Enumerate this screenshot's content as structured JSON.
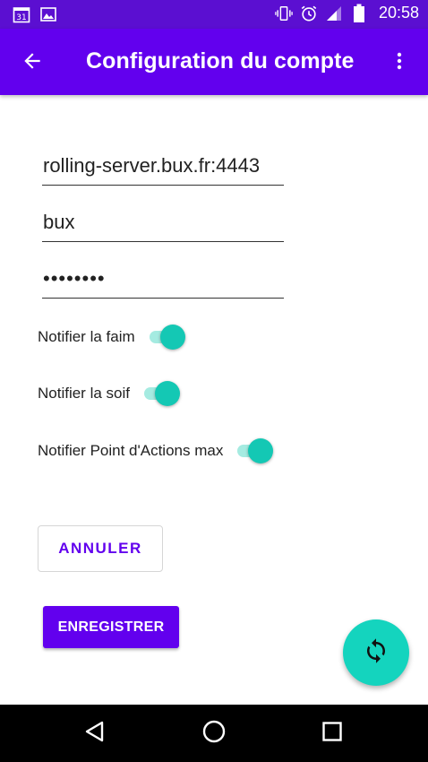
{
  "status_bar": {
    "calendar_day": "31",
    "time": "20:58",
    "icons": [
      "calendar-icon",
      "image-icon",
      "vibrate-icon",
      "alarm-icon",
      "signal-icon",
      "battery-icon"
    ]
  },
  "app_bar": {
    "title": "Configuration du compte",
    "back_icon": "arrow-left-icon",
    "menu_icon": "more-vertical-icon"
  },
  "form": {
    "server": {
      "value": "rolling-server.bux.fr:4443",
      "placeholder": ""
    },
    "username": {
      "value": "bux",
      "placeholder": ""
    },
    "password": {
      "value": "••••••••",
      "placeholder": ""
    }
  },
  "switches": [
    {
      "label": "Notifier la faim",
      "checked": true
    },
    {
      "label": "Notifier la soif",
      "checked": true
    },
    {
      "label": "Notifier Point d'Actions max",
      "checked": true
    }
  ],
  "buttons": {
    "cancel": "ANNULER",
    "save": "ENREGISTRER",
    "fab_icon": "sync-icon"
  },
  "colors": {
    "status_bar": "#5b0fd1",
    "app_bar": "#6200ee",
    "accent": "#14c8b4",
    "fab": "#14d4be",
    "switch_track": "#a5ebe1",
    "nav_bar": "#000000"
  },
  "nav_bar": {
    "icons": [
      "nav-back-icon",
      "nav-home-icon",
      "nav-recent-icon"
    ]
  }
}
